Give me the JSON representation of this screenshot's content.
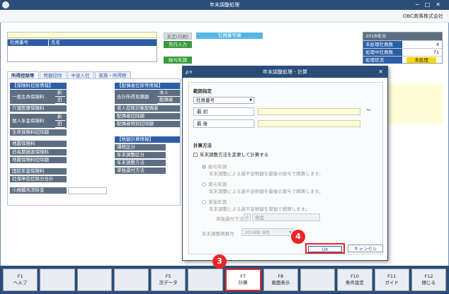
{
  "window": {
    "title": "年末調整処理",
    "company": "OBC商事株式会社"
  },
  "employee": {
    "col_no": "社員番号",
    "col_name": "氏名",
    "btn_print": "未定(印刷)",
    "btn_first": "先行入力",
    "btn_adjust": "給与年調",
    "list_header": "社員番号順"
  },
  "status": {
    "year": "2018年分",
    "rows": [
      {
        "label": "未処理社員数",
        "value": "4"
      },
      {
        "label": "処理中社員数",
        "value": "71"
      },
      {
        "label": "処理状況",
        "value": "未処理"
      }
    ]
  },
  "tabs": [
    "所得控除等",
    "税額控除",
    "中途入社",
    "家族・所得税"
  ],
  "left_panel": {
    "insurance_header": "【保険料控除情報】",
    "life_ins": "一般生命保険料",
    "new_label": "新",
    "old_label": "旧",
    "medical": "介護医療保険料",
    "pension": "個人年金保険料",
    "small_ins": "生命保険料控除額",
    "quake": "地震保険料",
    "long_ins": "旧長期損害保険料",
    "quake_total": "地震保険料控除額",
    "national_pension": "国民年金保険料",
    "social_ins": "社保申告控除分合計",
    "small_mutual": "小規模共済掛金"
  },
  "mid_panel": {
    "spouse_header": "【配偶者控除等情報】",
    "income_total": "合計所得見積額",
    "self": "本人",
    "spouse": "配偶者",
    "elderly": "老人控除対象配偶者",
    "spouse_deduct": "配偶者控除額",
    "spouse_special": "配偶者特別控除額",
    "calc_header": "【税額計算情報】",
    "tax_class": "課税区分",
    "adjust_class": "年末調整区分",
    "adjust_method": "年末調整方法",
    "refund_method": "単独還付方法"
  },
  "dialog": {
    "title": "年末調整処理 - 計算",
    "range_title": "範囲指定",
    "range_combo": "社員番号",
    "first_label": "最 初",
    "last_label": "最 後",
    "tilde": "～",
    "calc_title": "計算方法",
    "change_check": "年末調整方法を変更して計算する",
    "opt1": "給与年調",
    "opt1_desc": "年末調整による過不足税額を最後の給与で精算します。",
    "opt2": "賞与年調",
    "opt2_desc": "年末調整による過不足税額を最後の賞与で精算します。",
    "opt3": "単独年調",
    "opt3_desc": "年末調整による過不足税額を単独で精算します。",
    "refund_label": "単独還付方法",
    "refund_code": "0",
    "refund_value": "現金",
    "month_label": "年末調整精算月",
    "month_value": "2018年 9月",
    "ok": "OK",
    "cancel": "キャンセル",
    "step_ok": "4"
  },
  "fkeys": [
    {
      "key": "F1",
      "label": "ヘルプ"
    },
    {
      "key": "",
      "label": ""
    },
    {
      "key": "",
      "label": ""
    },
    {
      "key": "",
      "label": ""
    },
    {
      "key": "F5",
      "label": "次データ"
    },
    {
      "key": "",
      "label": ""
    },
    {
      "key": "F7",
      "label": "計算"
    },
    {
      "key": "F8",
      "label": "画面表示"
    },
    {
      "key": "",
      "label": ""
    },
    {
      "key": "F10",
      "label": "条件設定"
    },
    {
      "key": "F11",
      "label": "ガイド"
    },
    {
      "key": "F12",
      "label": "閉じる"
    }
  ],
  "step_calc": "3",
  "colors": {
    "accent": "#2b5ea6",
    "title": "#2a4d78",
    "highlight": "#e8262a"
  }
}
